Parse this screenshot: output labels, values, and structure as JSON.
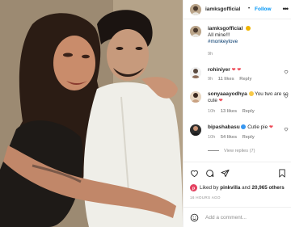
{
  "post": {
    "username": "iamksgofficial",
    "follow_label": "Follow",
    "separator": "•",
    "caption_line1": "All mine!!!",
    "caption_tag": "#monkeylove",
    "caption_time": "9h"
  },
  "comments": [
    {
      "username": "rohiniyer",
      "text": "",
      "time": "9h",
      "likes": "11 likes",
      "reply": "Reply"
    },
    {
      "username": "sonyaaayodhya",
      "text": "You two are so cute",
      "time": "10h",
      "likes": "13 likes",
      "reply": "Reply"
    },
    {
      "username": "bipashabasu",
      "text": "Cutie pie",
      "time": "10h",
      "likes": "54 likes",
      "reply": "Reply"
    }
  ],
  "view_replies": "View replies (7)",
  "liked_by": {
    "prefix": "Liked by",
    "user": "pinkvilla",
    "conj": "and",
    "others": "20,965 others"
  },
  "timestamp": "16 HOURS AGO",
  "add_comment_placeholder": "Add a comment...",
  "colors": {
    "accent": "#0095f6",
    "heart": "#ed4956",
    "muted": "#8e8e8e",
    "verified": "#3897f0"
  },
  "icons": [
    "more-icon",
    "verified-icon",
    "heart-icon",
    "comment-icon",
    "share-icon",
    "bookmark-icon",
    "emoji-icon"
  ]
}
